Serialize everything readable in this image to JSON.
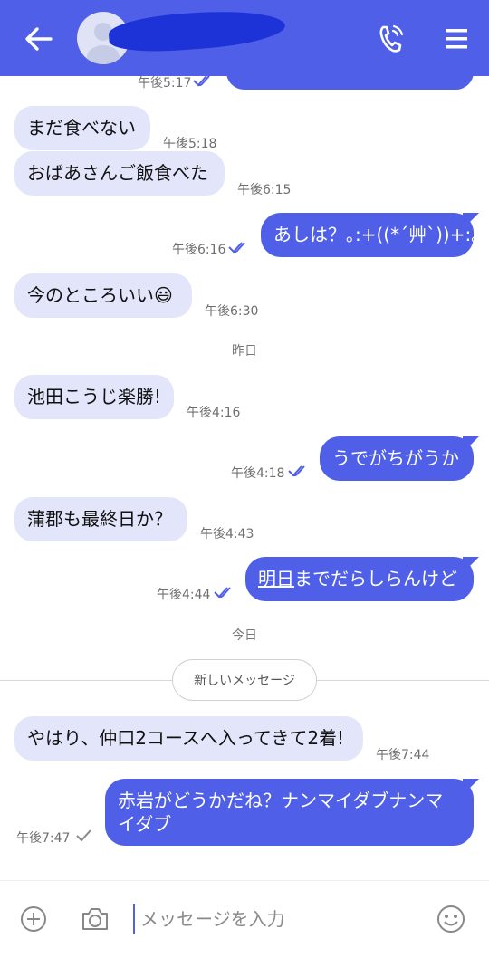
{
  "header": {
    "back_icon": "arrow-left-icon",
    "contact_name": "",
    "call_icon": "phone-icon",
    "menu_icon": "hamburger-menu-icon",
    "bar_color": "#4f5fe8"
  },
  "messages": [
    {
      "dir": "out",
      "text": "",
      "time": "午後5:17"
    },
    {
      "dir": "in",
      "text": "まだ食べない",
      "time": "午後5:18"
    },
    {
      "dir": "in",
      "text": "おばあさんご飯食べた",
      "time": "午後6:15"
    },
    {
      "dir": "out",
      "text": "あしは？｡:+((*´艸`))+:｡",
      "time": "午後6:16"
    },
    {
      "dir": "in",
      "text": "今のところいい",
      "emoji": "😃",
      "time": "午後6:30"
    },
    {
      "dir": "in",
      "text": "池田こうじ楽勝!",
      "time": "午後4:16"
    },
    {
      "dir": "out",
      "text": "うでがちがうか",
      "time": "午後4:18"
    },
    {
      "dir": "in",
      "text": "蒲郡も最終日か？",
      "time": "午後4:43"
    },
    {
      "dir": "out",
      "text_link": "明日",
      "text_rest": "までだらしらんけど",
      "time": "午後4:44"
    },
    {
      "dir": "in",
      "text": "やはり、仲口2コースへ入ってきて2着!",
      "time": "午後7:44"
    },
    {
      "dir": "out",
      "line1": "赤岩がどうかだね？ナンマイダブナンマ",
      "line2": "イダブ",
      "time": "午後7:47"
    }
  ],
  "date_separators": {
    "yesterday": "昨日",
    "today": "今日"
  },
  "new_messages_label": "新しいメッセージ",
  "composer": {
    "add_icon": "plus-circle-icon",
    "camera_icon": "camera-icon",
    "placeholder": "メッセージを入力",
    "emoji_icon": "smiley-icon"
  },
  "colors": {
    "accent": "#4f5fe8",
    "incoming_bubble": "#e3e6fa",
    "read_ticks": "#4f5fe8",
    "sent_tick": "#888888"
  }
}
